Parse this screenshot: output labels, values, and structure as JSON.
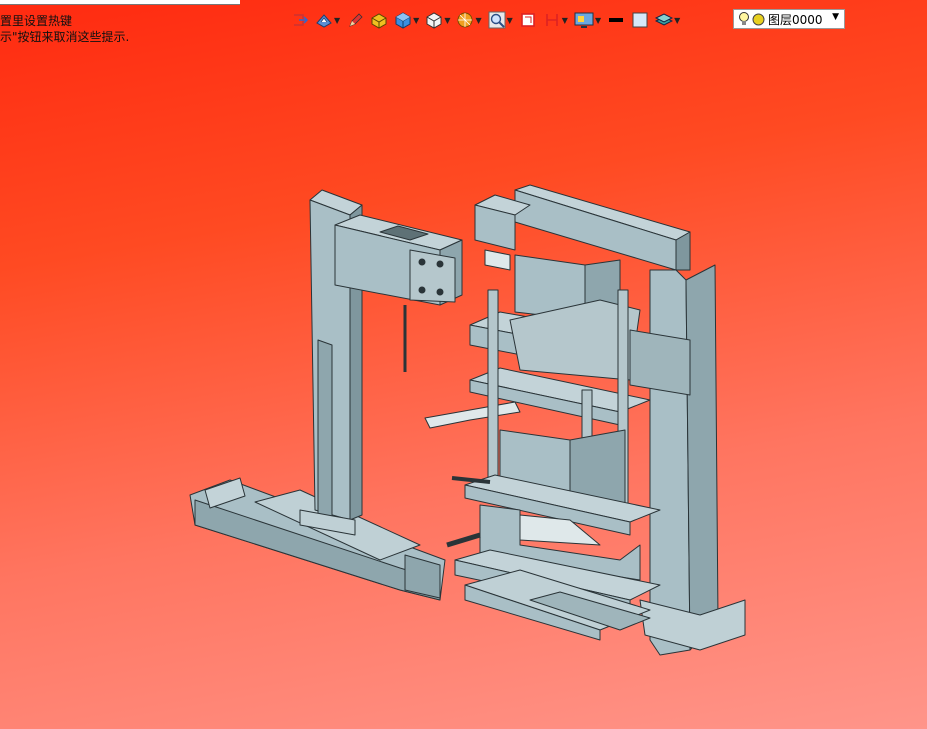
{
  "hints": {
    "line1": "置里设置热键",
    "line2": "示\"按钮来取消这些提示."
  },
  "toolbar": {
    "items": [
      {
        "name": "exit-sketch-icon"
      },
      {
        "name": "view-orient-icon"
      },
      {
        "name": "pencil-icon"
      },
      {
        "name": "box-yellow-icon"
      },
      {
        "name": "cube-blue-icon"
      },
      {
        "name": "cube-white-icon"
      },
      {
        "name": "sphere-icon"
      },
      {
        "name": "zoom-icon"
      },
      {
        "name": "red-frame-icon"
      },
      {
        "name": "section-icon"
      },
      {
        "name": "display-monitor-icon"
      },
      {
        "name": "line-black-icon"
      },
      {
        "name": "square-outline-icon"
      },
      {
        "name": "layers-stack-icon"
      }
    ],
    "layer_select": {
      "value": "图层0000"
    }
  },
  "colors": {
    "background_top": "#ff2a10",
    "background_bottom": "#ff958a",
    "model_face": "#a9bfc6",
    "model_edge": "#2a3438"
  }
}
